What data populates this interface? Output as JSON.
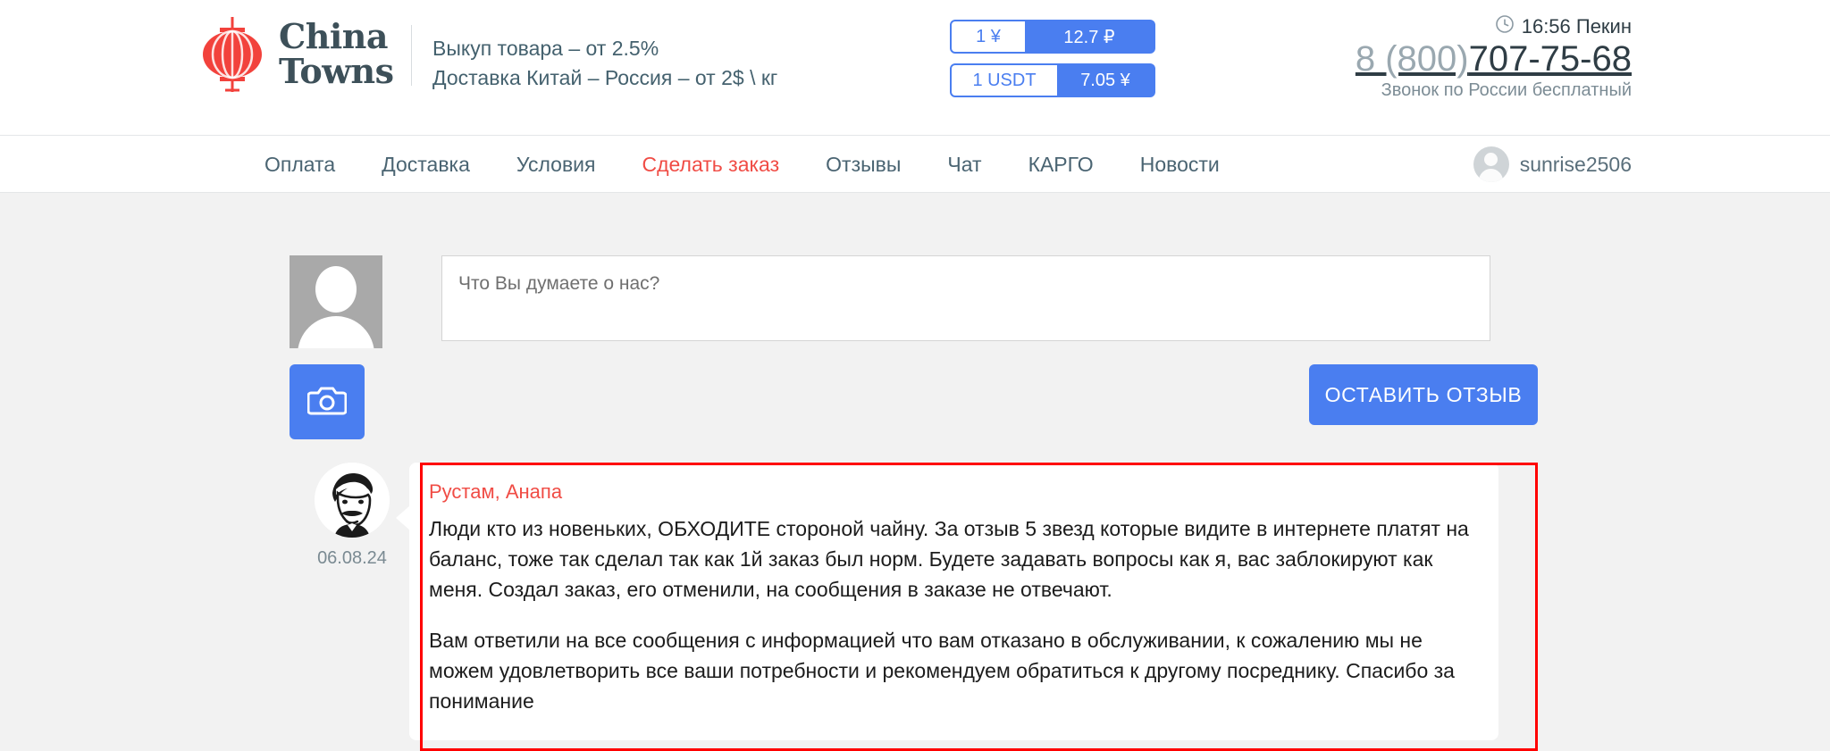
{
  "brand": {
    "name_line1": "China",
    "name_line2": "Towns",
    "logo_icon": "chinese-lantern-icon",
    "tagline_line1": "Выкуп товара – от 2.5%",
    "tagline_line2": "Доставка Китай – Россия – от 2$ \\ кг"
  },
  "currency": [
    {
      "from": "1 ¥",
      "to": "12.7 ₽"
    },
    {
      "from": "1 USDT",
      "to": "7.05 ¥"
    }
  ],
  "contacts": {
    "clock_icon": "clock-icon",
    "time": "16:56 Пекин",
    "phone_prefix": "8 (800)",
    "phone_main": "707-75-68",
    "note": "Звонок по России бесплатный"
  },
  "nav": {
    "items": [
      {
        "label": "Оплата",
        "active": false
      },
      {
        "label": "Доставка",
        "active": false
      },
      {
        "label": "Условия",
        "active": false
      },
      {
        "label": "Сделать заказ",
        "active": true
      },
      {
        "label": "Отзывы",
        "active": false
      },
      {
        "label": "Чат",
        "active": false
      },
      {
        "label": "КАРГО",
        "active": false
      },
      {
        "label": "Новости",
        "active": false
      }
    ],
    "user": {
      "avatar_icon": "user-avatar-icon",
      "name": "sunrise2506"
    }
  },
  "form": {
    "avatar_icon": "default-user-photo-icon",
    "textarea_placeholder": "Что Вы думаете о нас?",
    "textarea_value": "",
    "camera_icon": "camera-icon",
    "submit_label": "ОСТАВИТЬ ОТЗЫВ"
  },
  "review": {
    "avatar_icon": "user-photo-icon",
    "date": "06.08.24",
    "author": "Рустам, Анапа",
    "paragraph1": "Люди кто из новеньких, ОБХОДИТЕ стороной чайну. За отзыв 5 звезд которые видите в интернете платят на баланс, тоже так сделал так как 1й заказ был норм. Будете задавать вопросы как я, вас заблокируют как меня. Создал заказ, его отменили, на сообщения в заказе не отвечают.",
    "paragraph2": "Вам ответили на все сообщения с информацией что вам отказано в обслуживании, к сожалению мы не можем удовлетворить все ваши потребности и рекомендуем обратиться к другому посреднику. Спасибо за понимание"
  },
  "colors": {
    "accent_blue": "#4a7ef0",
    "accent_red": "#f04c45",
    "highlight_red": "#ff0000",
    "brand_dark": "#3d5059",
    "page_bg": "#f2f2f2"
  }
}
